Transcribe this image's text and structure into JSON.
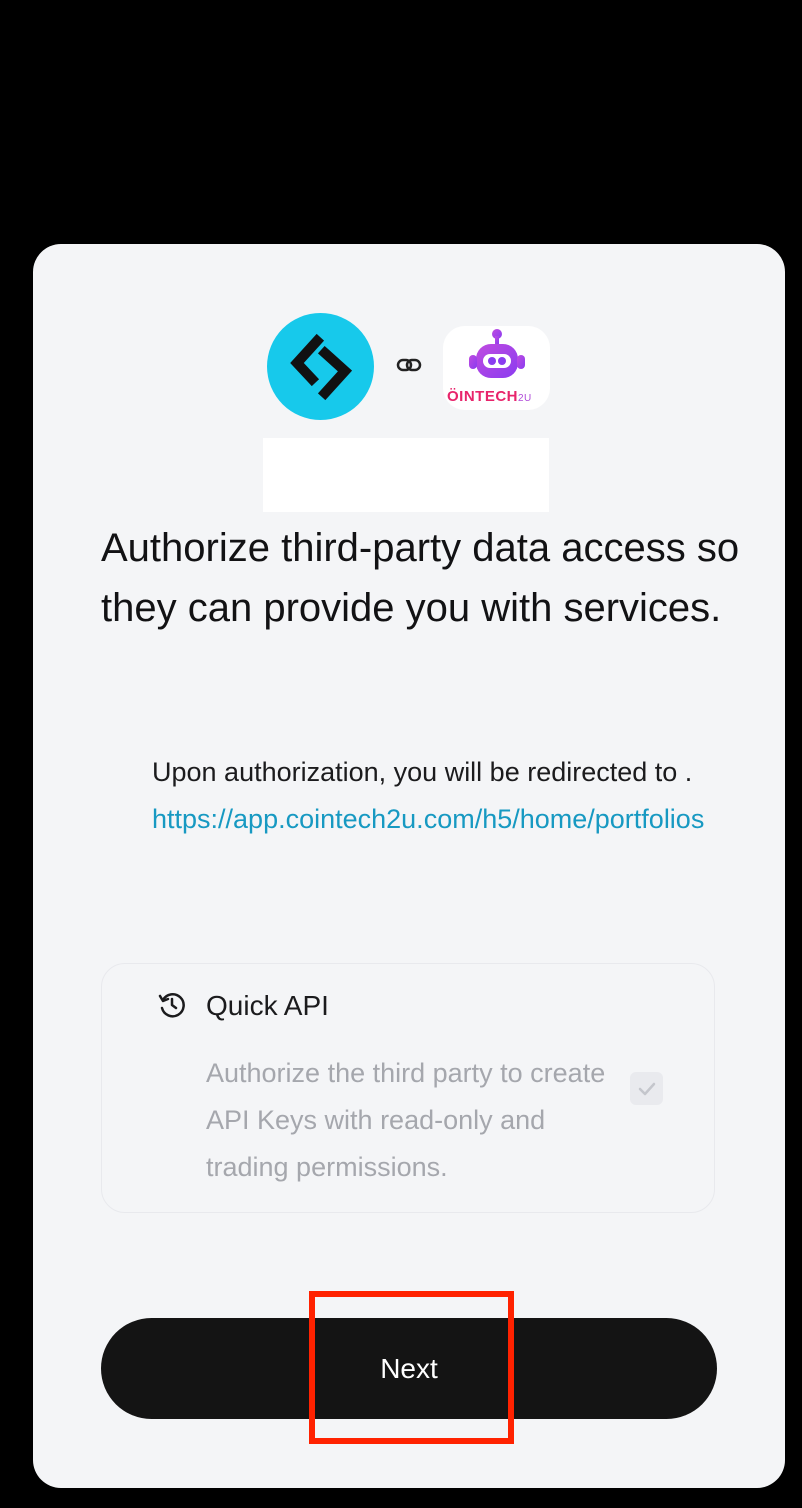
{
  "logos": {
    "left_icon": "bitget-logo-icon",
    "connector_icon": "link-icon",
    "right_icon": "cointech2u-logo-icon",
    "right_logo_text_main": "ÖINTECH",
    "right_logo_text_suffix": "2U"
  },
  "headline": "Authorize third-party data access so they can provide you with services.",
  "redirect": {
    "text": "Upon authorization, you will be redirected to .",
    "url": "https://app.cointech2u.com/h5/home/portfolios"
  },
  "quick_api": {
    "icon": "clock-refresh-icon",
    "title": "Quick API",
    "description": "Authorize the third party to create API Keys with read-only and trading permissions.",
    "checked": true
  },
  "actions": {
    "next_label": "Next"
  },
  "colors": {
    "page_bg": "#000000",
    "card_bg": "#f4f5f7",
    "left_logo_bg": "#17c9eb",
    "link": "#1799c2",
    "button_bg": "#141414",
    "highlight": "#ff2200"
  }
}
